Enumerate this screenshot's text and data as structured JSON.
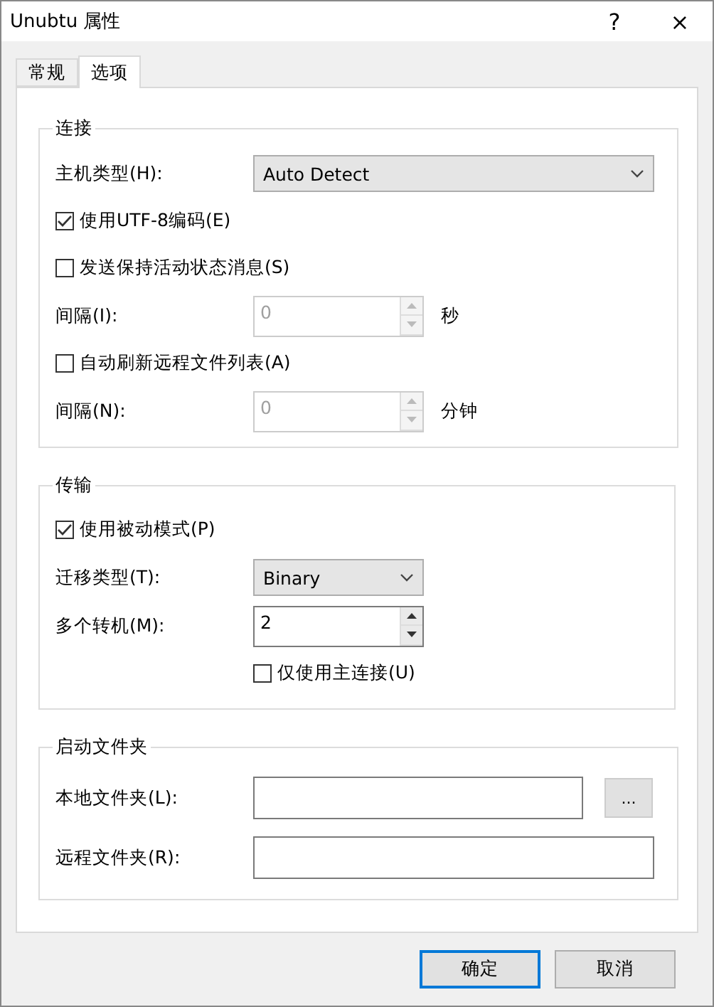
{
  "window": {
    "title": "Unubtu 属性",
    "help": "?",
    "close": "×"
  },
  "tabs": [
    {
      "label": "常规",
      "selected": false
    },
    {
      "label": "选项",
      "selected": true
    }
  ],
  "groups": [
    {
      "title": "连接",
      "rows": [
        {
          "kind": "combo-wide",
          "label": "主机类型(H):",
          "value": "Auto Detect"
        },
        {
          "kind": "checkbox",
          "label": "使用UTF-8编码(E)",
          "checked": true
        },
        {
          "kind": "checkbox",
          "label": "发送保持活动状态消息(S)",
          "checked": false
        },
        {
          "kind": "spin",
          "label": "间隔(I):",
          "value": "0",
          "unit": "秒",
          "disabled": true
        },
        {
          "kind": "checkbox",
          "label": "自动刷新远程文件列表(A)",
          "checked": false
        },
        {
          "kind": "spin",
          "label": "间隔(N):",
          "value": "0",
          "unit": "分钟",
          "disabled": true
        }
      ]
    },
    {
      "title": "传输",
      "rows": [
        {
          "kind": "checkbox",
          "label": "使用被动模式(P)",
          "checked": true
        },
        {
          "kind": "combo",
          "label": "迁移类型(T):",
          "value": "Binary"
        },
        {
          "kind": "spin",
          "label": "多个转机(M):",
          "value": "2",
          "disabled": false
        },
        {
          "kind": "sub-checkbox",
          "label": "仅使用主连接(U)",
          "checked": false
        }
      ]
    },
    {
      "title": "启动文件夹",
      "rows": [
        {
          "kind": "folder",
          "label": "本地文件夹(L):",
          "browse": "..."
        },
        {
          "kind": "folder",
          "label": "远程文件夹(R):"
        }
      ]
    }
  ],
  "buttons": [
    {
      "label": "确定",
      "default": true
    },
    {
      "label": "取消",
      "default": false
    }
  ]
}
